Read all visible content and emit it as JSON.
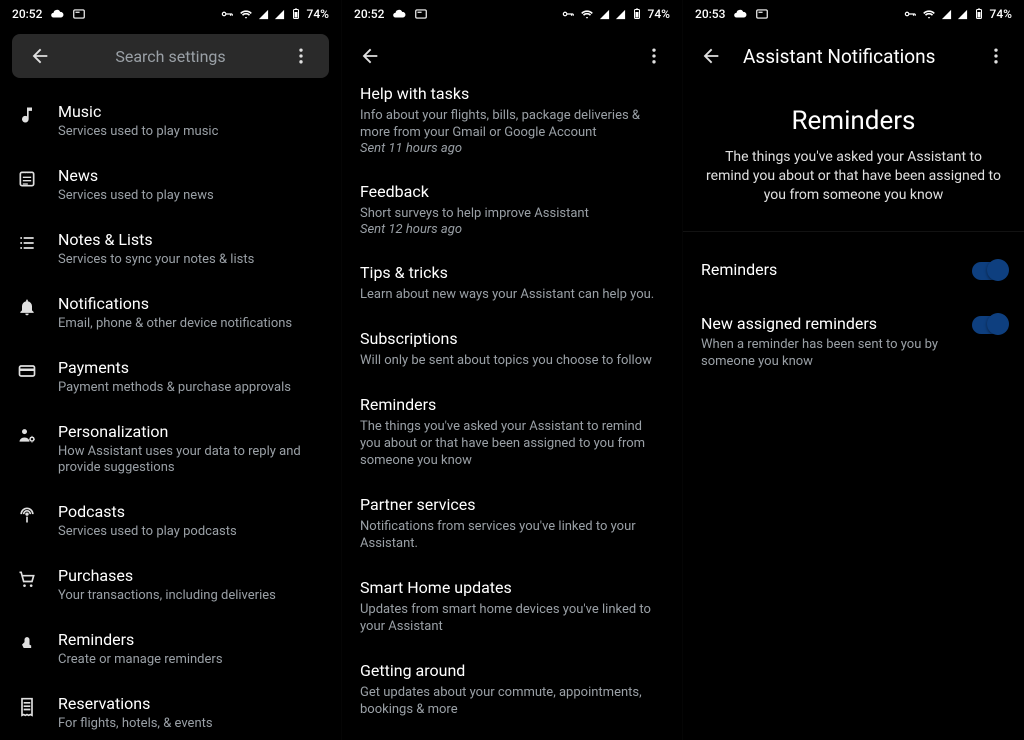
{
  "status": {
    "time_a": "20:52",
    "time_b": "20:52",
    "time_c": "20:53",
    "battery": "74%"
  },
  "screen1": {
    "search_placeholder": "Search settings",
    "items": [
      {
        "icon": "music",
        "title": "Music",
        "sub": "Services used to play music"
      },
      {
        "icon": "news",
        "title": "News",
        "sub": "Services used to play news"
      },
      {
        "icon": "list",
        "title": "Notes & Lists",
        "sub": "Services to sync your notes & lists"
      },
      {
        "icon": "bell",
        "title": "Notifications",
        "sub": "Email, phone & other device notifications"
      },
      {
        "icon": "card",
        "title": "Payments",
        "sub": "Payment methods & purchase approvals"
      },
      {
        "icon": "person-gear",
        "title": "Personalization",
        "sub": "How Assistant uses your data to reply and provide suggestions"
      },
      {
        "icon": "podcast",
        "title": "Podcasts",
        "sub": "Services used to play podcasts"
      },
      {
        "icon": "cart",
        "title": "Purchases",
        "sub": "Your transactions, including deliveries"
      },
      {
        "icon": "finger",
        "title": "Reminders",
        "sub": "Create or manage reminders"
      },
      {
        "icon": "receipt",
        "title": "Reservations",
        "sub": "For flights, hotels, & events"
      }
    ]
  },
  "screen2": {
    "categories": [
      {
        "title": "Help with tasks",
        "desc": "Info about your flights, bills, package deliveries & more from your Gmail or Google Account",
        "sent": "Sent 11 hours ago"
      },
      {
        "title": "Feedback",
        "desc": "Short surveys to help improve Assistant",
        "sent": "Sent 12 hours ago"
      },
      {
        "title": "Tips & tricks",
        "desc": "Learn about new ways your Assistant can help you."
      },
      {
        "title": "Subscriptions",
        "desc": "Will only be sent about topics you choose to follow"
      },
      {
        "title": "Reminders",
        "desc": "The things you've asked your Assistant to remind you about or that have been assigned to you from someone you know"
      },
      {
        "title": "Partner services",
        "desc": "Notifications from services you've linked to your Assistant."
      },
      {
        "title": "Smart Home updates",
        "desc": "Updates from smart home devices you've linked to your Assistant"
      },
      {
        "title": "Getting around",
        "desc": "Get updates about your commute, appointments, bookings & more"
      }
    ]
  },
  "screen3": {
    "appbar_title": "Assistant Notifications",
    "hero_title": "Reminders",
    "hero_desc": "The things you've asked your Assistant to remind you about or that have been assigned to you from someone you know",
    "toggles": [
      {
        "title": "Reminders",
        "desc": "",
        "on": true
      },
      {
        "title": "New assigned reminders",
        "desc": "When a reminder has been sent to you by someone you know",
        "on": true
      }
    ]
  }
}
